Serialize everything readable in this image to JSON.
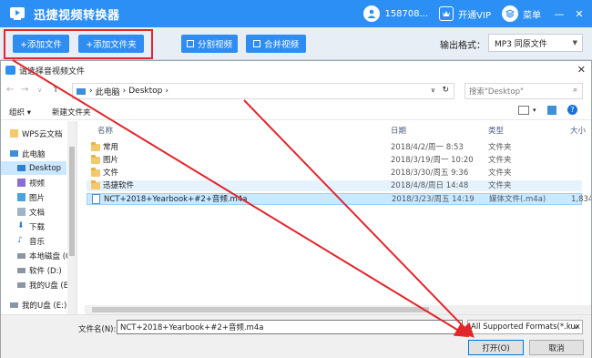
{
  "app": {
    "title": "迅捷视频转换器",
    "user_id": "158708...",
    "vip_label": "开通VIP",
    "menu_label": "菜单",
    "minimize": "—",
    "close": "✕"
  },
  "toolbar": {
    "add_file": "+添加文件",
    "add_folder": "+添加文件夹",
    "split_video": "分割视频",
    "merge_video": "合并视频",
    "output_format_label": "输出格式：",
    "output_format_value": "MP3  同原文件"
  },
  "dialog": {
    "title": "请选择音视频文件",
    "close": "✕",
    "breadcrumb": [
      "此电脑",
      "Desktop"
    ],
    "search_placeholder": "搜索\"Desktop\"",
    "organize": "组织 ▾",
    "new_folder": "新建文件夹",
    "columns": {
      "name": "名称",
      "date": "日期",
      "type": "类型",
      "size": "大小"
    },
    "nav_items": [
      {
        "label": "WPS云文档"
      },
      {
        "label": "此电脑"
      },
      {
        "label": "Desktop"
      },
      {
        "label": "视频"
      },
      {
        "label": "图片"
      },
      {
        "label": "文档"
      },
      {
        "label": "下载"
      },
      {
        "label": "音乐"
      },
      {
        "label": "本地磁盘 (C"
      },
      {
        "label": "软件 (D:)"
      },
      {
        "label": "我的U盘 (E"
      },
      {
        "label": "我的U盘 (E:)"
      }
    ],
    "files": [
      {
        "name": "常用",
        "date": "2018/4/2/周一 8:53",
        "type": "文件夹",
        "size": ""
      },
      {
        "name": "图片",
        "date": "2018/3/19/周一 10:20",
        "type": "文件夹",
        "size": ""
      },
      {
        "name": "文件",
        "date": "2018/3/30/周五 9:36",
        "type": "文件夹",
        "size": ""
      },
      {
        "name": "迅捷软件",
        "date": "2018/4/8/周日 14:48",
        "type": "文件夹",
        "size": ""
      },
      {
        "name": "NCT+2018+Yearbook+#2+音频.m4a",
        "date": "2018/3/23/周五 14:19",
        "type": "媒体文件(.m4a)",
        "size": "1,834 k"
      }
    ],
    "filename_label": "文件名(N):",
    "filename_value": "NCT+2018+Yearbook+#2+音频.m4a",
    "filetype_value": "All Supported Formats(*.kux",
    "open_label": "打开(O)",
    "cancel_label": "取消"
  },
  "colors": {
    "brand_blue": "#2b8ff3",
    "highlight_red": "#e3262b"
  }
}
